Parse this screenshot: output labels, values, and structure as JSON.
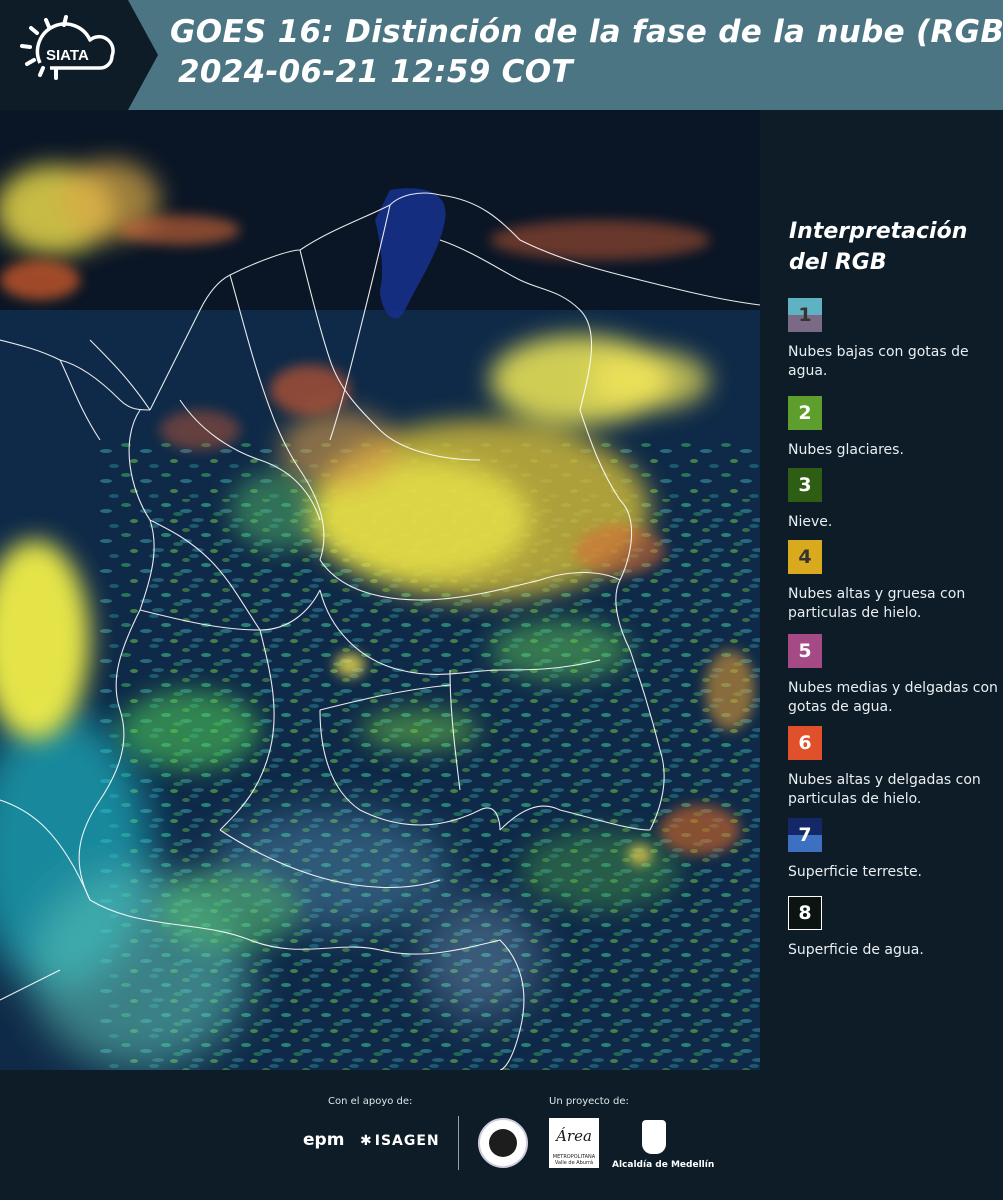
{
  "header": {
    "logo_text": "SIATA",
    "title_line1": "GOES 16: Distinción de la fase de la nube (RGB)",
    "title_line2": "2024-06-21 12:59 COT"
  },
  "map": {
    "description_icon": "satellite-rgb-map"
  },
  "legend": {
    "title": "Interpretación del RGB",
    "items": [
      {
        "number": "1",
        "label": "Nubes bajas con gotas de agua.",
        "color_top": "#5fb2c1",
        "color_bottom": "#7a6a86",
        "text_color": "#333333"
      },
      {
        "number": "2",
        "label": "Nubes glaciares.",
        "color_top": "#5e9e2c",
        "color_bottom": "#5e9e2c",
        "text_color": "#ffffff"
      },
      {
        "number": "3",
        "label": "Nieve.",
        "color_top": "#2d5e14",
        "color_bottom": "#2d5e14",
        "text_color": "#ffffff"
      },
      {
        "number": "4",
        "label": "Nubes altas y gruesa con particulas de hielo.",
        "color_top": "#d9aa1d",
        "color_bottom": "#d9aa1d",
        "text_color": "#333333"
      },
      {
        "number": "5",
        "label": "Nubes medias y delgadas con gotas de agua.",
        "color_top": "#a54a84",
        "color_bottom": "#a54a84",
        "text_color": "#ffffff"
      },
      {
        "number": "6",
        "label": "Nubes altas y delgadas con particulas de hielo.",
        "color_top": "#e0502a",
        "color_bottom": "#e0502a",
        "text_color": "#ffffff"
      },
      {
        "number": "7",
        "label": "Superficie terreste.",
        "color_top": "#142868",
        "color_bottom": "#3d70c0",
        "text_color": "#ffffff"
      },
      {
        "number": "8",
        "label": "Superficie de agua.",
        "color_top": "#0b1410",
        "color_bottom": "#0b1410",
        "text_color": "#ffffff"
      }
    ]
  },
  "footer": {
    "support_label": "Con el apoyo de:",
    "project_label": "Un proyecto de:",
    "epm": "epm",
    "isagen": "ISAGEN",
    "area_logo": "Área",
    "area_small": "METROPOLITANA Valle de Aburrá",
    "alcaldia": "Alcaldía de Medellín"
  }
}
